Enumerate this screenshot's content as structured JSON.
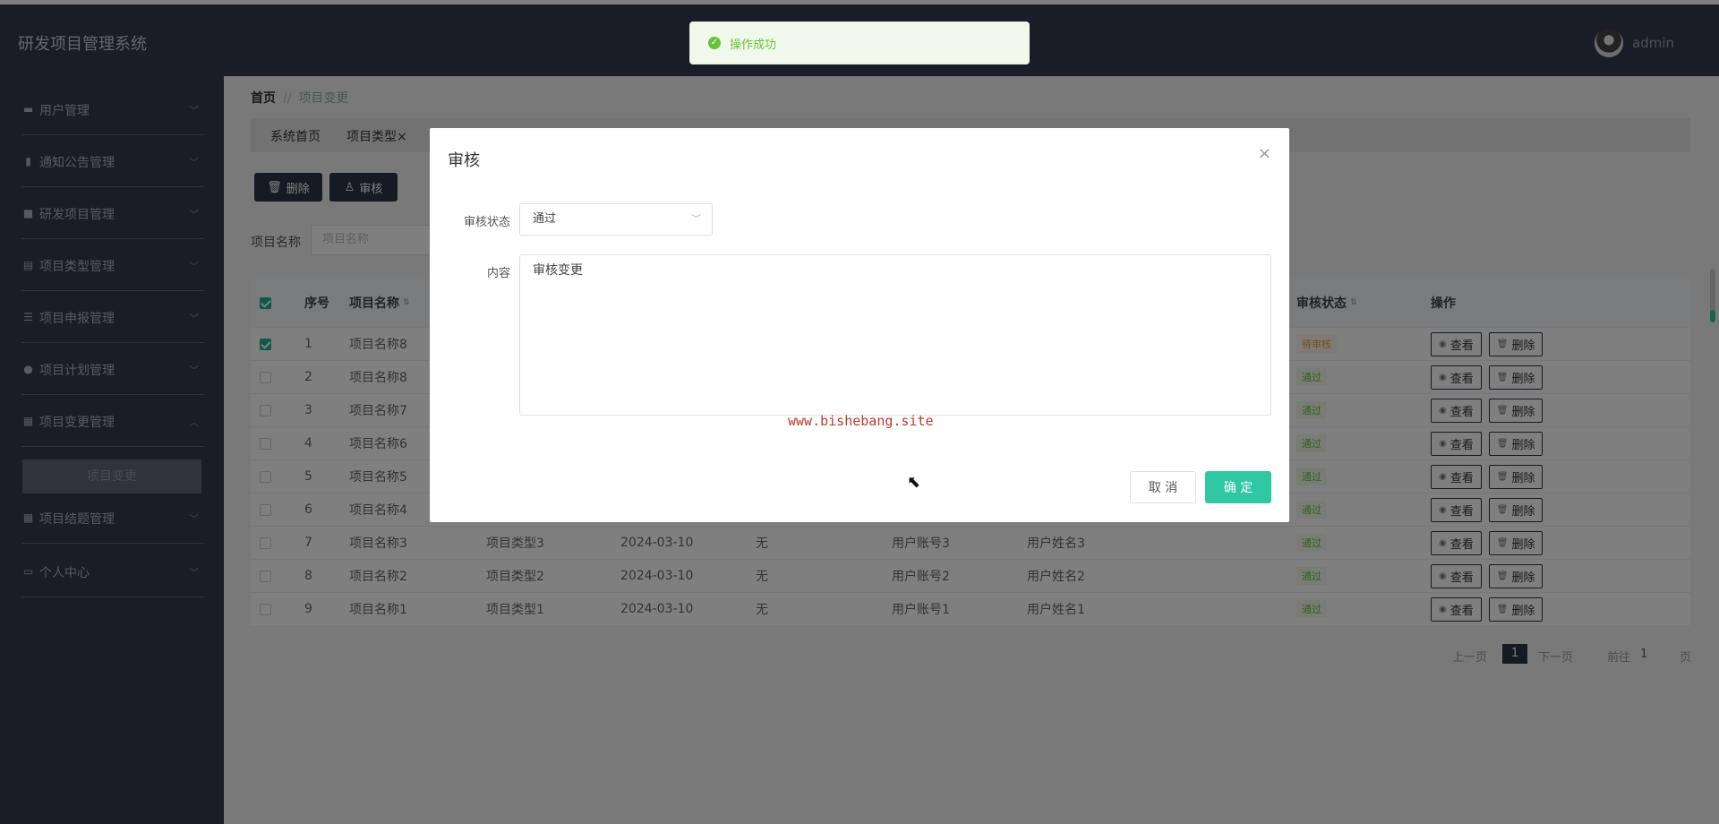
{
  "app": {
    "title": "研发项目管理系统",
    "username": "admin"
  },
  "toast": {
    "message": "操作成功"
  },
  "sidebar": {
    "items": [
      {
        "label": "用户管理",
        "icon": "user-group-icon"
      },
      {
        "label": "通知公告管理",
        "icon": "bar-chart-icon"
      },
      {
        "label": "研发项目管理",
        "icon": "briefcase-icon"
      },
      {
        "label": "项目类型管理",
        "icon": "document-icon"
      },
      {
        "label": "项目申报管理",
        "icon": "list-icon"
      },
      {
        "label": "项目计划管理",
        "icon": "person-icon"
      },
      {
        "label": "项目变更管理",
        "icon": "grid-icon",
        "expanded": true
      },
      {
        "label": "项目结题管理",
        "icon": "grid-icon"
      },
      {
        "label": "个人中心",
        "icon": "calendar-icon"
      }
    ],
    "sub_item": "项目变更"
  },
  "breadcrumb": {
    "home": "首页",
    "sep": "//",
    "current": "项目变更"
  },
  "tags": {
    "home": "系统首页",
    "type": "项目类型",
    "close": "×"
  },
  "toolbar": {
    "delete_label": "删除",
    "audit_label": "审核"
  },
  "search": {
    "label": "项目名称",
    "placeholder": "项目名称"
  },
  "table": {
    "headers": {
      "index": "序号",
      "name": "项目名称",
      "status": "审核状态",
      "ops": "操作"
    },
    "view_label": "查看",
    "delete_label": "删除",
    "rows": [
      {
        "idx": "1",
        "name": "项目名称8",
        "type": "",
        "date": "",
        "remark": "",
        "account": "",
        "uname": "",
        "status": "待审核",
        "checked": true
      },
      {
        "idx": "2",
        "name": "项目名称8",
        "type": "",
        "date": "",
        "remark": "",
        "account": "",
        "uname": "",
        "status": "通过",
        "checked": false
      },
      {
        "idx": "3",
        "name": "项目名称7",
        "type": "",
        "date": "",
        "remark": "",
        "account": "",
        "uname": "",
        "status": "通过",
        "checked": false
      },
      {
        "idx": "4",
        "name": "项目名称6",
        "type": "",
        "date": "",
        "remark": "",
        "account": "",
        "uname": "",
        "status": "通过",
        "checked": false
      },
      {
        "idx": "5",
        "name": "项目名称5",
        "type": "",
        "date": "",
        "remark": "",
        "account": "",
        "uname": "",
        "status": "通过",
        "checked": false
      },
      {
        "idx": "6",
        "name": "项目名称4",
        "type": "",
        "date": "",
        "remark": "",
        "account": "",
        "uname": "",
        "status": "通过",
        "checked": false
      },
      {
        "idx": "7",
        "name": "项目名称3",
        "type": "项目类型3",
        "date": "2024-03-10",
        "remark": "无",
        "account": "用户账号3",
        "uname": "用户姓名3",
        "status": "通过",
        "checked": false
      },
      {
        "idx": "8",
        "name": "项目名称2",
        "type": "项目类型2",
        "date": "2024-03-10",
        "remark": "无",
        "account": "用户账号2",
        "uname": "用户姓名2",
        "status": "通过",
        "checked": false
      },
      {
        "idx": "9",
        "name": "项目名称1",
        "type": "项目类型1",
        "date": "2024-03-10",
        "remark": "无",
        "account": "用户账号1",
        "uname": "用户姓名1",
        "status": "通过",
        "checked": false
      }
    ]
  },
  "pagination": {
    "prev": "上一页",
    "current": "1",
    "next": "下一页",
    "goto": "前往",
    "page_value": "1",
    "page_unit": "页"
  },
  "dialog": {
    "title": "审核",
    "close": "×",
    "status_label": "审核状态",
    "status_value": "通过",
    "content_label": "内容",
    "content_value": "审核变更",
    "watermark": "www.bishebang.site",
    "cancel_label": "取 消",
    "confirm_label": "确 定"
  },
  "colors": {
    "sidebar_bg": "#303b4f",
    "accent": "#2fc8a2",
    "success": "#67c23a",
    "warning": "#e6a23c"
  }
}
